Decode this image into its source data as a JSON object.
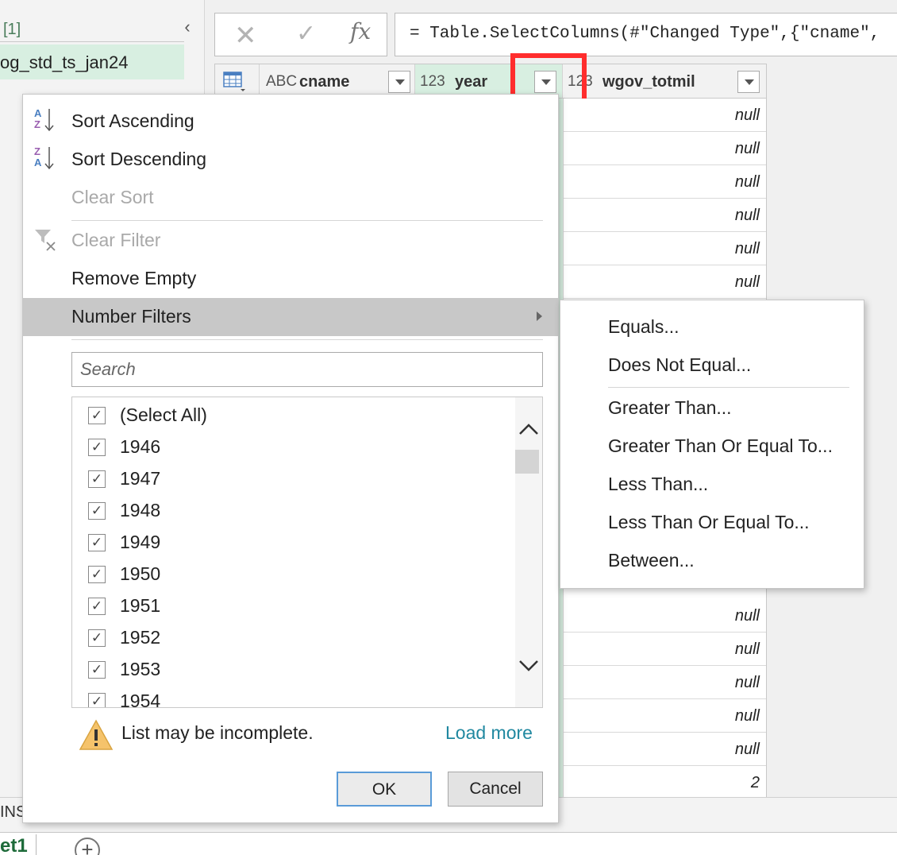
{
  "queries_pane": {
    "count_label": "[1]",
    "collapse_glyph": "‹",
    "query_name": "og_std_ts_jan24"
  },
  "formula_bar": {
    "cancel_glyph": "✕",
    "accept_glyph": "✓",
    "fx_label": "fx",
    "formula": "= Table.SelectColumns(#\"Changed Type\",{\"cname\","
  },
  "grid": {
    "columns": [
      {
        "type_glyph": "ABC",
        "name": "cname"
      },
      {
        "type_glyph": "123",
        "name": "year"
      },
      {
        "type_glyph": "123",
        "name": "wgov_totmil"
      }
    ],
    "visible_cells_top": [
      "null",
      "null",
      "null",
      "null",
      "null",
      "null"
    ],
    "visible_cells_bottom": [
      "null",
      "null",
      "null",
      "null",
      "null",
      "2"
    ]
  },
  "filter_menu": {
    "sort_ascending": "Sort Ascending",
    "sort_descending": "Sort Descending",
    "clear_sort": "Clear Sort",
    "clear_filter": "Clear Filter",
    "remove_empty": "Remove Empty",
    "number_filters": "Number Filters",
    "search_placeholder": "Search",
    "list_items": [
      {
        "label": "(Select All)",
        "checked": true
      },
      {
        "label": "1946",
        "checked": true
      },
      {
        "label": "1947",
        "checked": true
      },
      {
        "label": "1948",
        "checked": true
      },
      {
        "label": "1949",
        "checked": true
      },
      {
        "label": "1950",
        "checked": true
      },
      {
        "label": "1951",
        "checked": true
      },
      {
        "label": "1952",
        "checked": true
      },
      {
        "label": "1953",
        "checked": true
      },
      {
        "label": "1954",
        "checked": true
      }
    ],
    "warning_text": "List may be incomplete.",
    "load_more": "Load more",
    "ok_label": "OK",
    "cancel_label": "Cancel"
  },
  "number_filters_submenu": {
    "items": [
      "Equals...",
      "Does Not Equal...",
      "Greater Than...",
      "Greater Than Or Equal To...",
      "Less Than...",
      "Less Than Or Equal To...",
      "Between..."
    ]
  },
  "status": {
    "left_text": "INS",
    "sheet_tab": "et1",
    "add_sheet_glyph": "+"
  },
  "colors": {
    "accent_green": "#d8efe1",
    "highlight_red": "#ff2d2d",
    "link_teal": "#2088a0",
    "menu_active": "#c8c8c8"
  }
}
